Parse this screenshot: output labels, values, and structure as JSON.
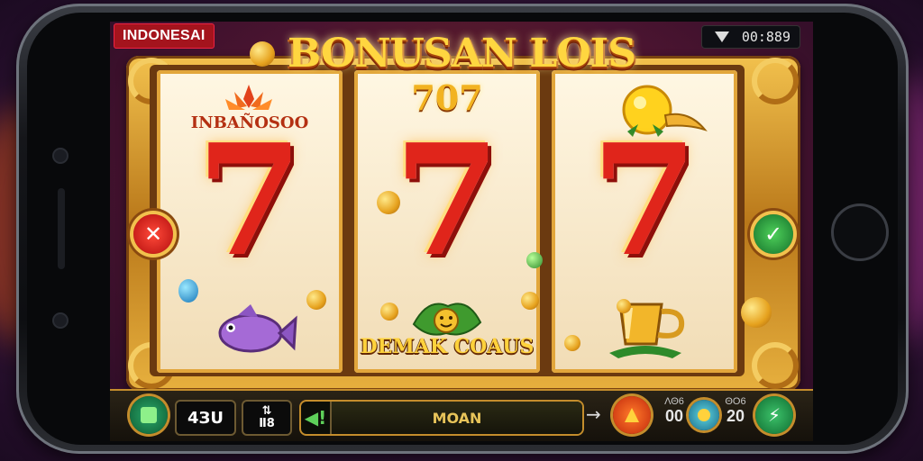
{
  "screen": {
    "country_badge": "INDONESAI",
    "status_time": "00:889"
  },
  "game": {
    "title": "BONUSAN LOIS",
    "reel1": {
      "label": "INBAÑOSOO",
      "symbol": "7"
    },
    "reel2": {
      "label": "707",
      "symbol": "7",
      "bottom_text": "DEMAK COAUS"
    },
    "reel3": {
      "symbol": "7"
    }
  },
  "controls": {
    "balance": "4ЗU",
    "bet_top": "⇅",
    "bet_bottom": "Ⅱ8",
    "action_arrow": "◀!",
    "action_label": "MOAN",
    "right_arrow": "→",
    "stat1_top": "ΛΘ6",
    "stat1_bottom": "00",
    "stat2_top": "ΘO6",
    "stat2_bottom": "20"
  },
  "colors": {
    "accent_gold": "#f2c14d",
    "seven_red": "#e0251b",
    "cancel_red": "#d11d1d",
    "confirm_green": "#1b8f3a"
  },
  "icons": {
    "left_side": "close-icon",
    "right_side": "check-icon",
    "wifi": "wifi-icon",
    "spin": "spin-icon"
  }
}
